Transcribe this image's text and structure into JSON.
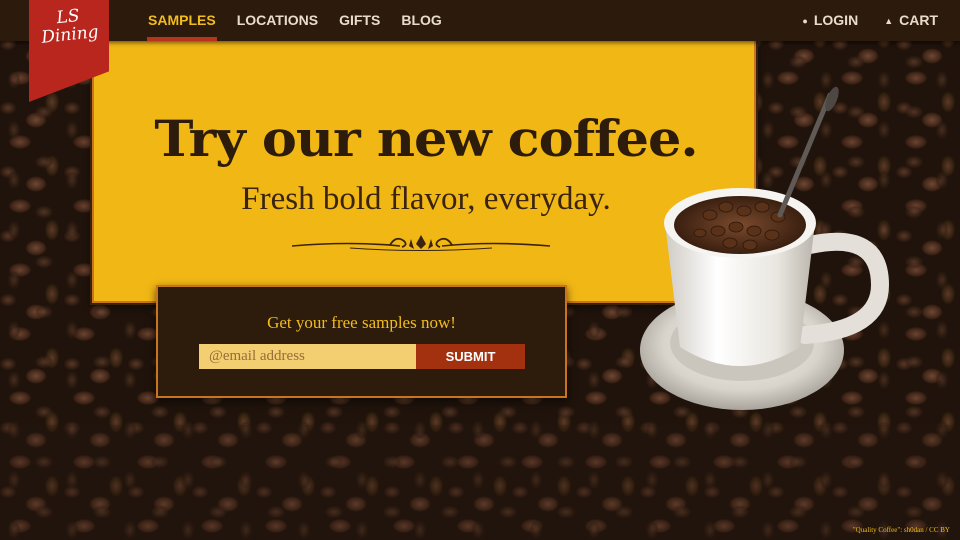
{
  "brand": {
    "logo_text": "LS Dining"
  },
  "nav": {
    "items": [
      {
        "label": "SAMPLES",
        "active": true
      },
      {
        "label": "LOCATIONS",
        "active": false
      },
      {
        "label": "GIFTS",
        "active": false
      },
      {
        "label": "BLOG",
        "active": false
      }
    ],
    "right_items": [
      {
        "label": "LOGIN",
        "icon": "user-icon"
      },
      {
        "label": "CART",
        "icon": "cart-icon"
      }
    ]
  },
  "hero": {
    "title": "Try our new coffee.",
    "subtitle": "Fresh bold flavor, everyday."
  },
  "signup": {
    "heading": "Get your free samples now!",
    "email_placeholder": "@email address",
    "email_value": "",
    "submit_label": "SUBMIT"
  },
  "credit": {
    "text": "\"Quality Coffee\": sh0dan / CC BY"
  },
  "colors": {
    "header_bg": "#2c1a0c",
    "accent_yellow": "#f0b715",
    "accent_red": "#b8261e",
    "active_nav": "#f1bd1e",
    "submit_bg": "#a3310f"
  }
}
